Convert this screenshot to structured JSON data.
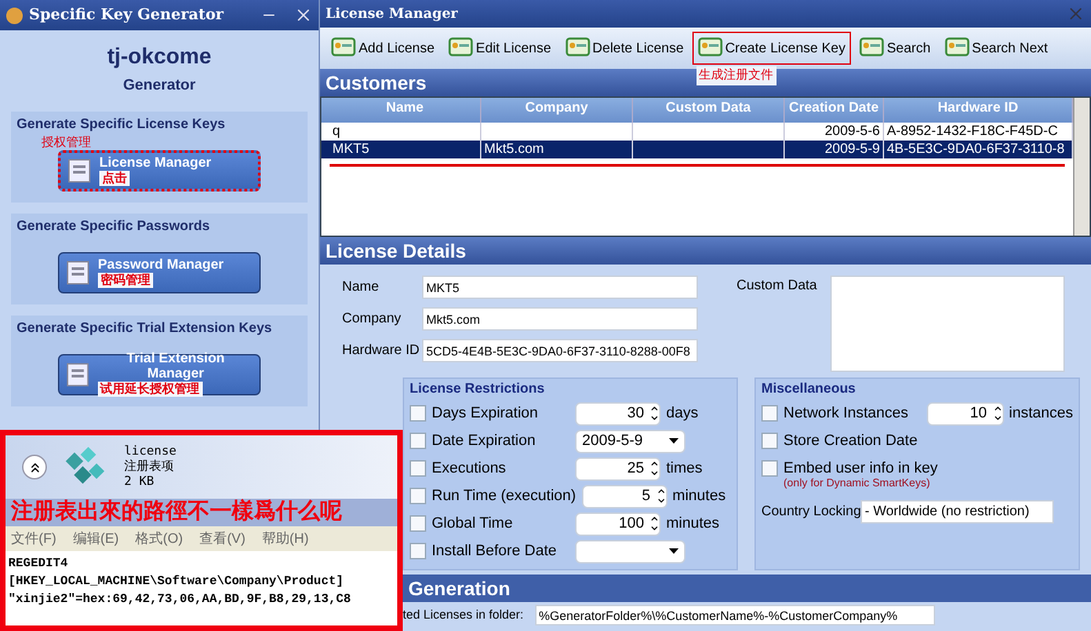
{
  "key_generator": {
    "title": "Specific Key Generator",
    "app_name": "tj-okcome",
    "subtitle": "Generator",
    "sections": [
      {
        "heading": "Generate Specific License Keys",
        "button": "License Manager",
        "note_above": "授权管理",
        "note_on": "点击",
        "framed": true
      },
      {
        "heading": "Generate Specific Passwords",
        "button": "Password Manager",
        "note_on": "密码管理",
        "framed": false
      },
      {
        "heading": "Generate Specific Trial Extension Keys",
        "button": "Trial Extension Manager",
        "note_on": "试用延长授权管理",
        "framed": false
      }
    ]
  },
  "overlay": {
    "file_name": "license",
    "file_type": "注册表项",
    "file_size": "2 KB",
    "caption": "注册表出來的路徑不一樣爲什么呢",
    "menu": [
      "文件(F)",
      "编辑(E)",
      "格式(O)",
      "查看(V)",
      "帮助(H)"
    ],
    "lines": [
      "REGEDIT4",
      "[HKEY_LOCAL_MACHINE\\Software\\Company\\Product]",
      "\"xinjie2\"=hex:69,42,73,06,AA,BD,9F,B8,29,13,C8"
    ]
  },
  "license_manager": {
    "title": "License Manager",
    "toolbar": [
      {
        "label": "Add License",
        "framed": false
      },
      {
        "label": "Edit License",
        "framed": false
      },
      {
        "label": "Delete License",
        "framed": false
      },
      {
        "label": "Create License Key",
        "framed": true,
        "note": "生成注册文件"
      },
      {
        "label": "Search",
        "framed": false
      },
      {
        "label": "Search Next",
        "framed": false
      }
    ],
    "customers": {
      "title": "Customers",
      "columns": [
        "Name",
        "Company",
        "Custom Data",
        "Creation Date",
        "Hardware ID"
      ],
      "rows": [
        {
          "cells": [
            "q",
            "",
            "",
            "2009-5-6",
            "A-8952-1432-F18C-F45D-C"
          ],
          "selected": false
        },
        {
          "cells": [
            "MKT5",
            "Mkt5.com",
            "",
            "2009-5-9",
            "4B-5E3C-9DA0-6F37-3110-8"
          ],
          "selected": true
        }
      ]
    },
    "details": {
      "title": "License Details",
      "fields": [
        {
          "label": "Name",
          "value": "MKT5"
        },
        {
          "label": "Company",
          "value": "Mkt5.com"
        },
        {
          "label": "Hardware ID",
          "value": "5CD5-4E4B-5E3C-9DA0-6F37-3110-8288-00F8"
        }
      ],
      "custom_data_label": "Custom Data"
    },
    "restrictions": {
      "title": "License Restrictions",
      "items": [
        {
          "kind": "spinner",
          "label": "Days Expiration",
          "checked": false,
          "value": "30",
          "unit": "days"
        },
        {
          "kind": "dropdown",
          "label": "Date Expiration",
          "checked": false,
          "value": "2009-5-9"
        },
        {
          "kind": "spinner",
          "label": "Executions",
          "checked": false,
          "value": "25",
          "unit": "times"
        },
        {
          "kind": "spinner",
          "label": "Run Time (execution)",
          "checked": false,
          "value": "5",
          "unit": "minutes"
        },
        {
          "kind": "spinner",
          "label": "Global Time",
          "checked": false,
          "value": "100",
          "unit": "minutes"
        },
        {
          "kind": "dropdown",
          "label": "Install Before Date",
          "checked": false
        }
      ]
    },
    "misc": {
      "title": "Miscellaneous",
      "items": [
        {
          "kind": "spinner",
          "label": "Network Instances",
          "checked": false,
          "value": "10",
          "unit": "instances"
        },
        {
          "kind": "checkbox",
          "label": "Store Creation Date",
          "checked": false
        },
        {
          "kind": "checkbox",
          "label": "Embed user info in key",
          "checked": false,
          "hint": "(only for Dynamic SmartKeys)"
        }
      ],
      "country_label": "Country Locking",
      "country_value": "- Worldwide (no restriction)"
    },
    "generation": {
      "title": "Generation",
      "folder_label": "ted Licenses in folder:",
      "folder_value": "%GeneratorFolder%\\%CustomerName%-%CustomerCompany%"
    }
  }
}
